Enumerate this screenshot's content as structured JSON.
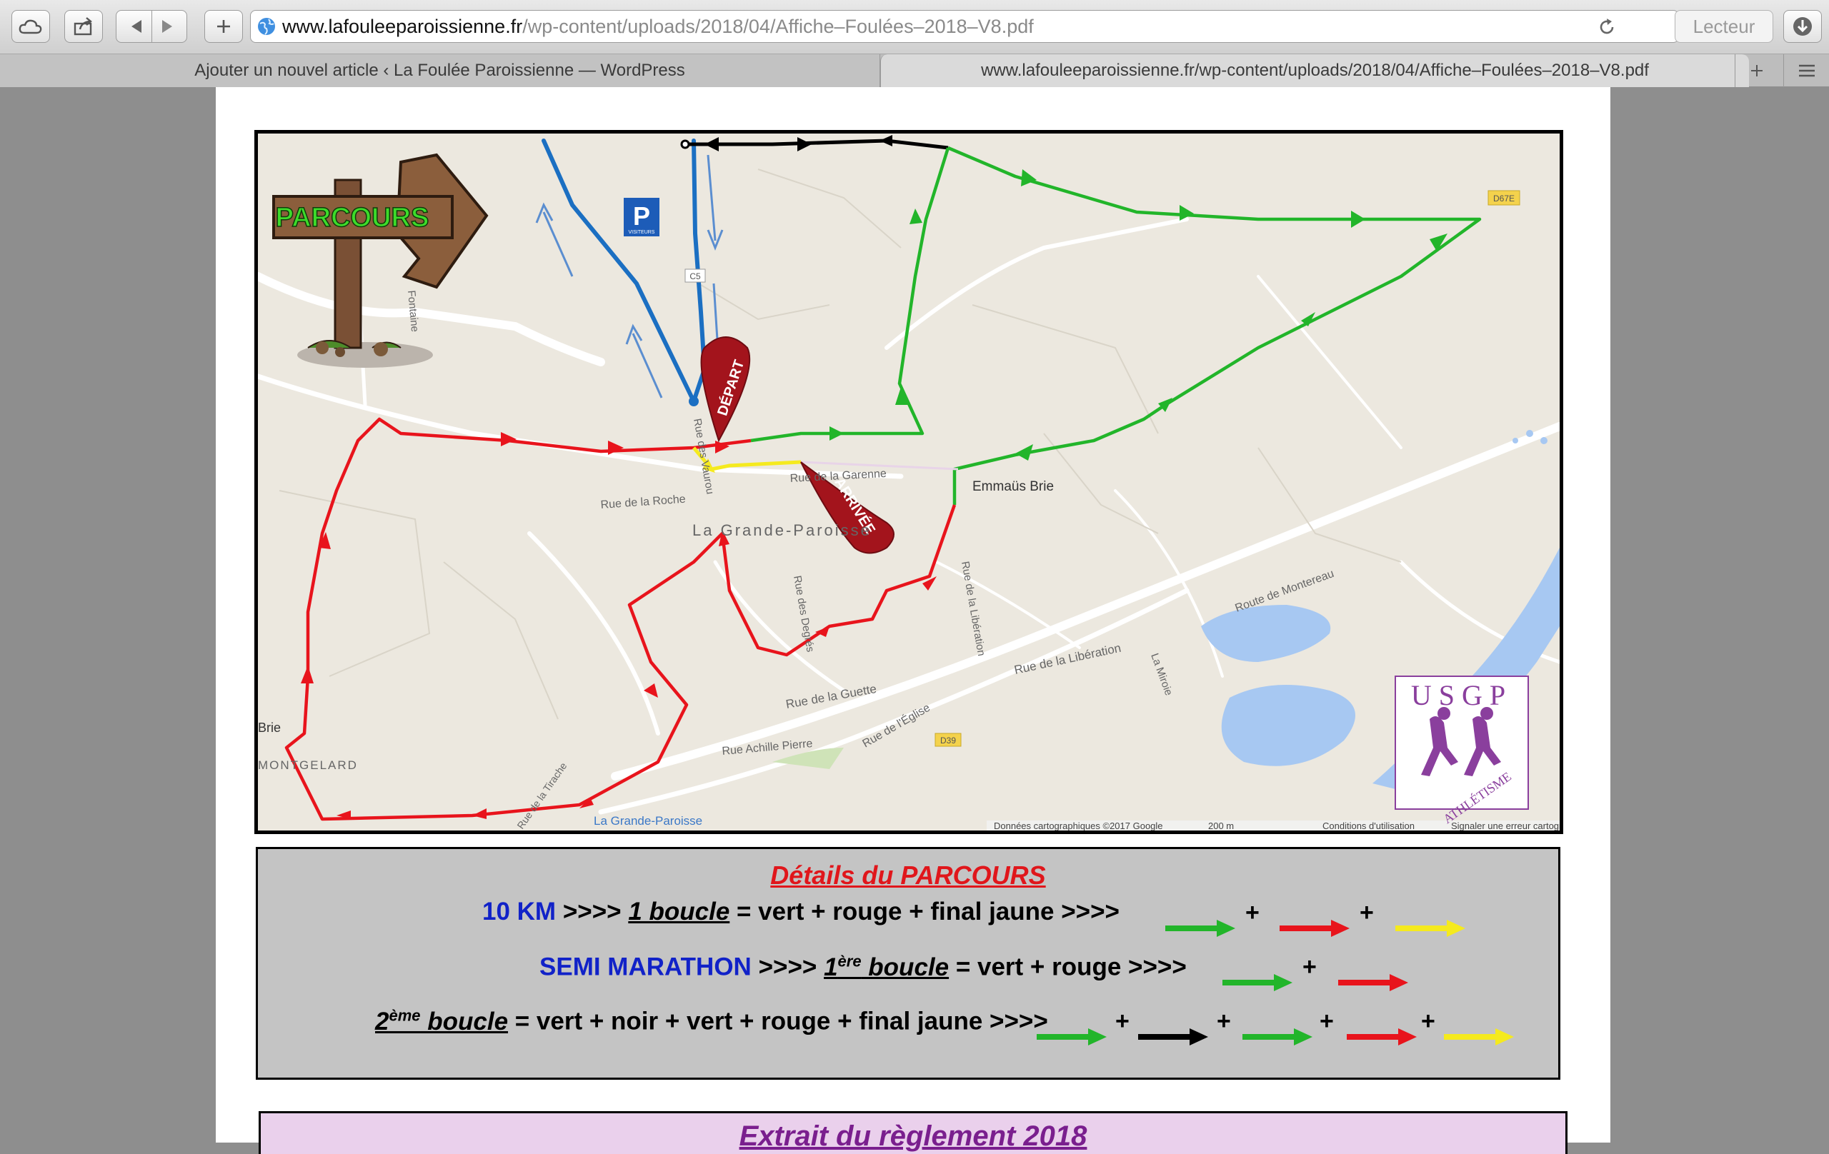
{
  "browser": {
    "url_host": "www.lafouleeparoissienne.fr",
    "url_path": "/wp-content/uploads/2018/04/Affiche–Foulées–2018–V8.pdf",
    "reader_label": "Lecteur",
    "tabs": [
      {
        "label": "Ajouter un nouvel article ‹ La Foulée Paroissienne — WordPress",
        "active": false
      },
      {
        "label": "www.lafouleeparoissienne.fr/wp-content/uploads/2018/04/Affiche–Foulées–2018–V8.pdf",
        "active": true
      }
    ]
  },
  "map": {
    "sign_label": "PARCOURS",
    "parking_label": "P",
    "parking_sub": "VISITEURS",
    "depart_label": "DÉPART",
    "arrivee_label": "ARRIVÉE",
    "town_label": "La Grande-Paroisse",
    "emmaus_label": "Emmaüs Brie",
    "brie_label": "Brie",
    "montgelard_label": "MONTGELARD",
    "station_label": "La Grande-Paroisse",
    "fontaine_label": "Fontaine",
    "rue_garenne": "Rue de la Garenne",
    "rue_roche": "Rue de la Roche",
    "rue_vaurou": "Rue des Vaurou",
    "rue_degres": "Rue des Degrés",
    "rue_guette": "Rue de la Guette",
    "rue_achille": "Rue Achille Pierre",
    "rue_eglise": "Rue de l'Église",
    "rue_liberation": "Rue de la Libération",
    "rue_liberation_v": "Rue de la Libération",
    "route_montereau": "Route de Montereau",
    "la_miroie": "La Miroie",
    "rue_tirache": "Rue de la Tirache",
    "road_c5": "C5",
    "road_d67e": "D67E",
    "road_d39": "D39",
    "attribution": "Données cartographiques ©2017 Google",
    "scale": "200 m",
    "conditions": "Conditions d'utilisation",
    "report": "Signaler une erreur cartographique",
    "logo_letters": "USGP",
    "logo_sub": "ATHLÉTISME"
  },
  "details": {
    "title": "Détails du PARCOURS",
    "line1_blue": "10 KM",
    "line1_sep": " >>>> ",
    "line1_boucle": "1 boucle",
    "line1_rest": " = vert + rouge + final jaune >>>>",
    "line2_blue": "SEMI MARATHON",
    "line2_sep": " >>>>  ",
    "line2_num": "1",
    "line2_sup": "ère",
    "line2_boucle": " boucle",
    "line2_rest": " = vert + rouge >>>>",
    "line3_num": "2",
    "line3_sup": "ème",
    "line3_boucle": " boucle",
    "line3_rest": " = vert + noir + vert + rouge + final jaune >>>>",
    "plus": "+"
  },
  "extrait": {
    "title": "Extrait du règlement 2018"
  },
  "colors": {
    "green": "#22b52a",
    "red": "#e8141c",
    "yellow": "#f5ea1e",
    "black": "#000000",
    "blue": "#1b6fc2"
  }
}
